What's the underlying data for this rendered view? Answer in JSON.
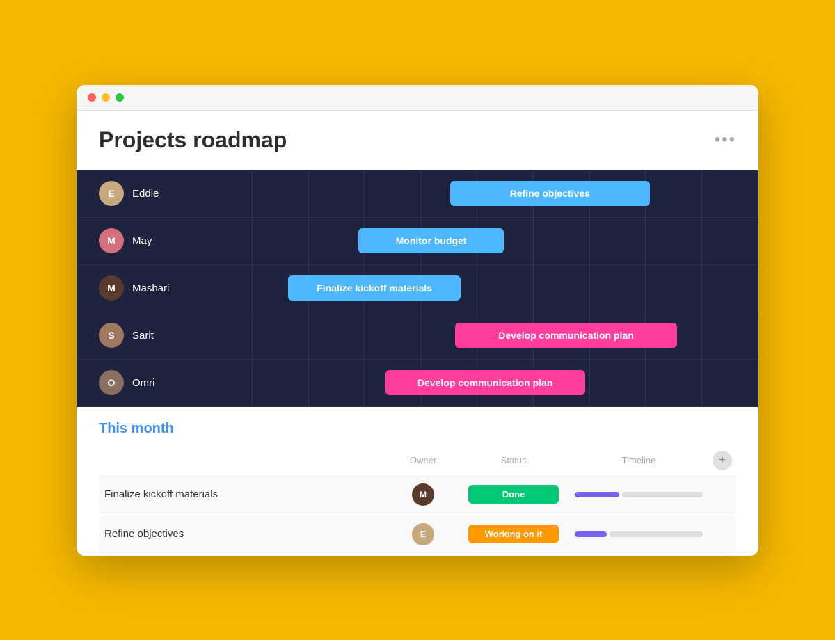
{
  "window": {
    "title": "Projects roadmap",
    "more_label": "•••"
  },
  "gantt": {
    "rows": [
      {
        "id": "eddie",
        "name": "Eddie",
        "bar_label": "Refine objectives",
        "bar_color": "bar-blue",
        "bar_left": "47%",
        "bar_width": "37%"
      },
      {
        "id": "may",
        "name": "May",
        "bar_label": "Monitor budget",
        "bar_color": "bar-blue",
        "bar_left": "30%",
        "bar_width": "27%"
      },
      {
        "id": "mashari",
        "name": "Mashari",
        "bar_label": "Finalize kickoff materials",
        "bar_color": "bar-blue",
        "bar_left": "17%",
        "bar_width": "30%"
      },
      {
        "id": "sarit",
        "name": "Sarit",
        "bar_label": "Develop communication plan",
        "bar_color": "bar-pink",
        "bar_left": "48%",
        "bar_width": "40%"
      },
      {
        "id": "omri",
        "name": "Omri",
        "bar_label": "Develop communication plan",
        "bar_color": "bar-pink",
        "bar_left": "35%",
        "bar_width": "37%"
      }
    ]
  },
  "bottom": {
    "section_title": "This month",
    "columns": {
      "owner": "Owner",
      "status": "Status",
      "timeline": "Timeline"
    },
    "rows": [
      {
        "task": "Finalize kickoff materials",
        "owner_id": "mashari",
        "status_label": "Done",
        "status_class": "status-done",
        "tl_fill_width": "35%"
      },
      {
        "task": "Refine objectives",
        "owner_id": "eddie",
        "status_label": "Working on it",
        "status_class": "status-working",
        "tl_fill_width": "25%"
      }
    ]
  }
}
